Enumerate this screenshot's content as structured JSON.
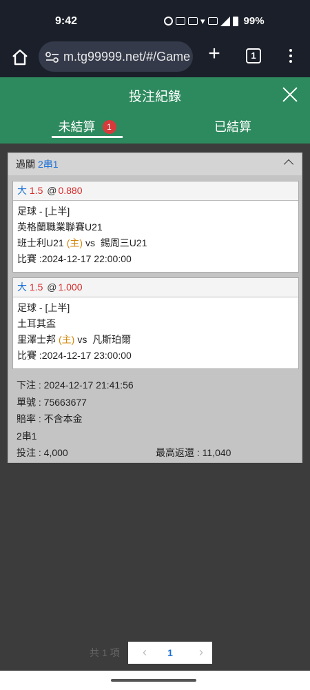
{
  "status_bar": {
    "time": "9:42",
    "battery_pct": "99%"
  },
  "browser": {
    "url": "m.tg99999.net/#/Game",
    "tab_count": "1"
  },
  "header": {
    "title": "投注紀錄"
  },
  "tabs": [
    {
      "label": "未結算",
      "badge": "1",
      "active": true
    },
    {
      "label": "已結算",
      "active": false
    }
  ],
  "bet": {
    "label": "過關",
    "parlay_type": "2串1",
    "legs": [
      {
        "pick": "大",
        "line": "1.5",
        "at": "@",
        "odds": "0.880",
        "market": "足球 - [上半]",
        "league": "英格蘭職業聯賽U21",
        "home_team": "班士利U21",
        "home_tag": "(主)",
        "vs": "vs",
        "away_team": "錫周三U21",
        "match_time": "比賽 :2024-12-17 22:00:00"
      },
      {
        "pick": "大",
        "line": "1.5",
        "at": "@",
        "odds": "1.000",
        "market": "足球 - [上半]",
        "league": "土耳其盃",
        "home_team": "里澤士邦",
        "home_tag": "(主)",
        "vs": "vs",
        "away_team": "凡斯珀爾",
        "match_time": "比賽 :2024-12-17 23:00:00"
      }
    ],
    "placed": "下注 : 2024-12-17 21:41:56",
    "ticket_no": "單號 : 75663677",
    "odds_type": "賠率 : 不含本金",
    "combo": "2串1",
    "stake": "投注 : 4,000",
    "max_return": "最高返還 : 11,040"
  },
  "pagination": {
    "total_label": "共 1 項",
    "prev": "‹",
    "current": "1",
    "next": "›"
  },
  "colors": {
    "header_green": "#2d8a5e",
    "accent_blue": "#1a6fd6",
    "odds_red": "#d62a2a",
    "home_orange": "#d4870a"
  }
}
